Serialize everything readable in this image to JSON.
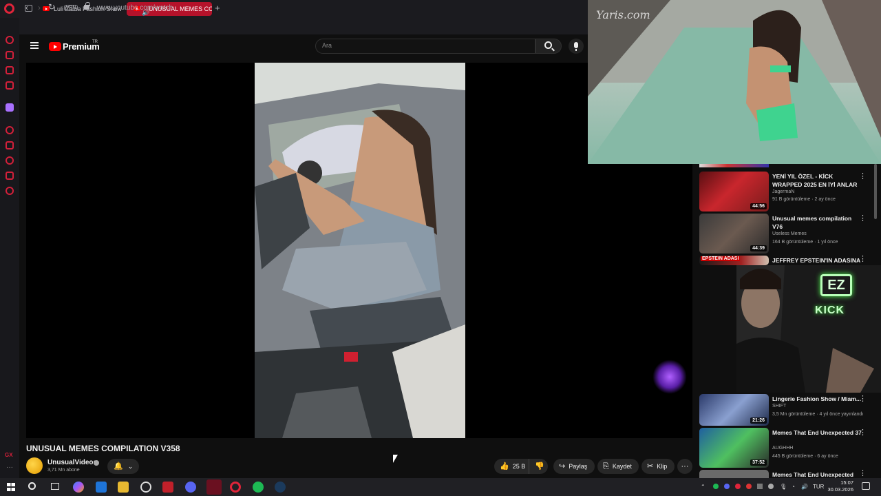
{
  "browser": {
    "tabs": [
      {
        "label": "Luli Fama Fashion Show S",
        "active": false
      },
      {
        "label": "UNUSUAL MEMES CO",
        "active": true
      }
    ],
    "new_tab": "+",
    "vpn_label": "VPN",
    "url": "www.youtube.com/watch",
    "nav": {
      "back": "‹",
      "forward": "›",
      "reload": "↻"
    }
  },
  "youtube": {
    "logo_text": "Premium",
    "logo_badge": "TR",
    "search_placeholder": "Ara"
  },
  "video": {
    "title": "UNUSUAL MEMES COMPILATION V358",
    "channel": "UnusualVideos",
    "subscribers": "3,71 Mn abone",
    "likes": "25 B",
    "actions": {
      "share": "Paylaş",
      "save": "Kaydet",
      "clip": "Klip"
    }
  },
  "related": [
    {
      "title": "YENİ YIL ÖZEL - KİCK WRAPPED 2025 EN İYİ ANLAR",
      "channel": "JagermaN",
      "views": "91 B görüntüleme",
      "age": "2 ay önce",
      "duration": "44:56"
    },
    {
      "title": "Unusual memes compilation V76",
      "channel": "Useless Memes",
      "views": "164 B görüntüleme",
      "age": "1 yıl önce",
      "duration": "44:39"
    },
    {
      "title": "JEFFREY EPSTEIN'IN ADASINA",
      "thumb_text": "EPSTEIN ADASI"
    },
    {
      "title": "Lingerie Fashion Show / Miam...",
      "channel": "SHIFT",
      "views": "3,5 Mn görüntüleme",
      "age": "4 yıl önce yayınlandı",
      "duration": "21:26"
    },
    {
      "title": "Memes That End Unexpected 37",
      "channel": "AUGHHH",
      "views": "445 B görüntüleme",
      "age": "6 ay önce",
      "duration": "37:52"
    },
    {
      "title": "Memes That End Unexpected"
    }
  ],
  "overlays": {
    "watermark": "Yaris.com",
    "cam_logo": "EZ",
    "cam_brand": "KICK"
  },
  "sidebar": {
    "gx_label": "GX",
    "more": "···"
  },
  "taskbar": {
    "lang": "TUR",
    "time": "15:07",
    "date": "30.03.2026"
  }
}
